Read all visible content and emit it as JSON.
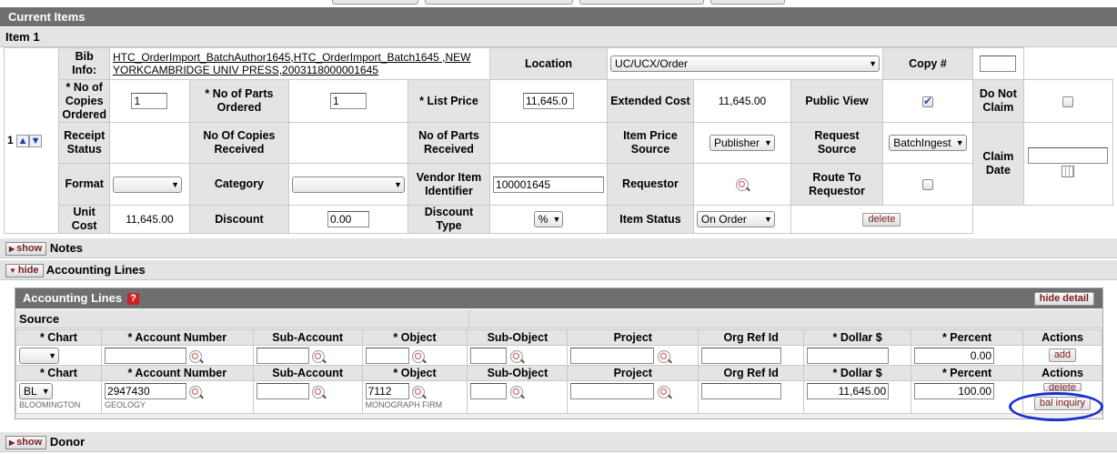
{
  "current_items": {
    "title": "Current Items",
    "item_title": "Item 1",
    "row_number": "1",
    "bib_info": {
      "label": "Bib Info:",
      "line1": "HTC_OrderImport_BatchAuthor1645,HTC_OrderImport_Batch1645 ,NEW",
      "line2": "YORKCAMBRIDGE UNIV PRESS,2003118000001645"
    },
    "location": {
      "label": "Location",
      "value": "UC/UCX/Order"
    },
    "copy_no": {
      "label": "Copy #",
      "value": ""
    },
    "copies_ordered": {
      "label": "* No of Copies Ordered",
      "value": "1"
    },
    "parts_ordered": {
      "label": "* No of Parts Ordered",
      "value": "1"
    },
    "list_price": {
      "label": "* List Price",
      "value": "11,645.0"
    },
    "extended_cost": {
      "label": "Extended Cost",
      "value": "11,645.00"
    },
    "public_view": {
      "label": "Public View",
      "checked": true
    },
    "do_not_claim": {
      "label": "Do Not Claim",
      "checked": false
    },
    "receipt_status": {
      "label": "Receipt Status",
      "value": ""
    },
    "copies_received": {
      "label": "No Of Copies Received",
      "value": ""
    },
    "parts_received": {
      "label": "No of Parts Received",
      "value": ""
    },
    "item_price_source": {
      "label": "Item Price Source",
      "value": "Publisher"
    },
    "request_source": {
      "label": "Request Source",
      "value": "BatchIngest"
    },
    "claim_date": {
      "label": "Claim Date",
      "value": ""
    },
    "format": {
      "label": "Format",
      "value": ""
    },
    "category": {
      "label": "Category",
      "value": ""
    },
    "vendor_item_id": {
      "label": "Vendor Item Identifier",
      "value": "100001645"
    },
    "requestor": {
      "label": "Requestor"
    },
    "route_to_requestor": {
      "label": "Route To Requestor",
      "checked": false
    },
    "unit_cost": {
      "label": "Unit Cost",
      "value": "11,645.00"
    },
    "discount": {
      "label": "Discount",
      "value": "0.00"
    },
    "discount_type": {
      "label": "Discount Type",
      "value": "%"
    },
    "item_status": {
      "label": "Item Status",
      "value": "On Order"
    },
    "delete_label": "delete"
  },
  "notes": {
    "toggle": "show",
    "title": "Notes"
  },
  "accounting": {
    "toggle": "hide",
    "title": "Accounting Lines",
    "panel_title": "Accounting Lines",
    "help": "?",
    "hide_detail": "hide detail",
    "source_label": "Source",
    "headers": [
      "* Chart",
      "* Account Number",
      "Sub-Account",
      "* Object",
      "Sub-Object",
      "Project",
      "Org Ref Id",
      "* Dollar $",
      "* Percent",
      "Actions"
    ],
    "new_line": {
      "chart": "",
      "account": "",
      "sub_account": "",
      "object": "",
      "sub_object": "",
      "project": "",
      "org_ref": "",
      "dollar": "",
      "percent": "0.00",
      "action": "add"
    },
    "line1": {
      "chart": "BL",
      "chart_name": "BLOOMINGTON",
      "account": "2947430",
      "account_name": "GEOLOGY",
      "sub_account": "",
      "object": "7112",
      "object_name": "MONOGRAPH FIRM",
      "sub_object": "",
      "project": "",
      "org_ref": "",
      "dollar": "11,645.00",
      "percent": "100.00",
      "delete": "delete",
      "bal_inquiry": "bal inquiry"
    }
  },
  "donor": {
    "toggle": "show",
    "title": "Donor"
  },
  "colors": {
    "header_bg": "#6f6f6f",
    "label_bg": "#e4e4e4",
    "highlight_circle": "#1a2fd0"
  }
}
